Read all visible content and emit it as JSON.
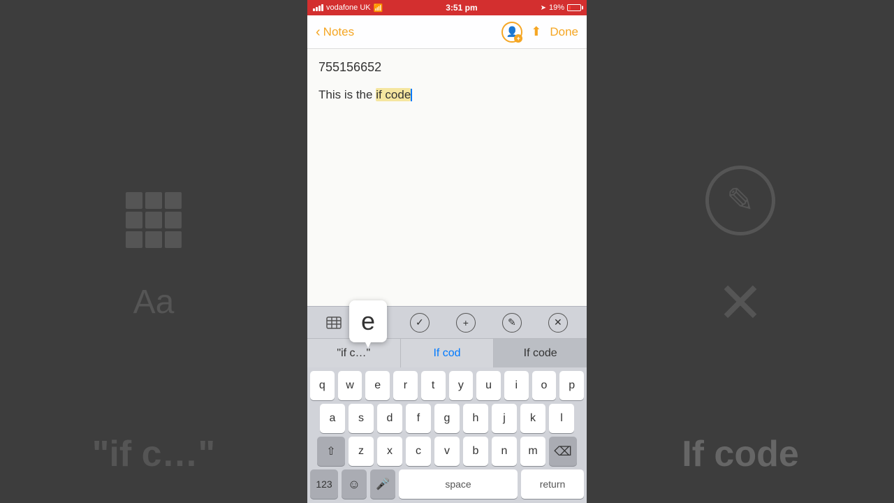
{
  "status_bar": {
    "carrier": "vodafone UK",
    "time": "3:51 pm",
    "battery_percent": "19%",
    "signal_bars": 4
  },
  "nav_bar": {
    "back_label": "Notes",
    "done_label": "Done"
  },
  "note": {
    "number": "755156652",
    "text_prefix": "This is the ",
    "text_highlight": "if code",
    "text_cursor": true
  },
  "formatting_toolbar": {
    "table_icon": "⊞",
    "aa_icon": "Aa",
    "check_icon": "✓",
    "plus_icon": "+",
    "pencil_icon": "✎",
    "close_icon": "✕"
  },
  "autocomplete": {
    "option1": "\"if c…\"",
    "option2": "If cod",
    "option3": "If code",
    "key_popup_letter": "e"
  },
  "keyboard": {
    "row1": [
      "q",
      "w",
      "e",
      "r",
      "t",
      "y",
      "u",
      "i",
      "o",
      "p"
    ],
    "row2": [
      "a",
      "s",
      "d",
      "f",
      "g",
      "h",
      "j",
      "k",
      "l"
    ],
    "row3": [
      "z",
      "x",
      "c",
      "v",
      "b",
      "n",
      "m"
    ],
    "bottom_left": "123",
    "emoji": "☺",
    "mic": "🎤",
    "space": "space",
    "return": "return",
    "delete": "⌫"
  },
  "left_panel": {
    "grid_label": "table-icon",
    "aa_label": "Aa",
    "quote_text": "\"if c…\""
  },
  "right_panel": {
    "pencil_label": "pencil-circle",
    "x_label": "✕",
    "if_code_label": "If code"
  }
}
